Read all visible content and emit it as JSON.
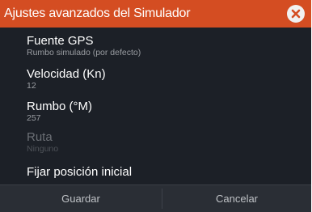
{
  "dialog": {
    "title": "Ajustes avanzados del Simulador",
    "close_icon": "close-x-icon"
  },
  "settings": [
    {
      "label": "Fuente GPS",
      "value": "Rumbo simulado (por defecto)",
      "enabled": true
    },
    {
      "label": "Velocidad (Kn)",
      "value": "12",
      "enabled": true
    },
    {
      "label": "Rumbo (°M)",
      "value": "257",
      "enabled": true
    },
    {
      "label": "Ruta",
      "value": "Ninguno",
      "enabled": false
    }
  ],
  "action": {
    "label": "Fijar posición inicial"
  },
  "buttons": {
    "save": "Guardar",
    "cancel": "Cancelar"
  },
  "colors": {
    "titlebar": "#d44d22",
    "background": "#1c2027",
    "buttonbar": "#2a2e35"
  }
}
